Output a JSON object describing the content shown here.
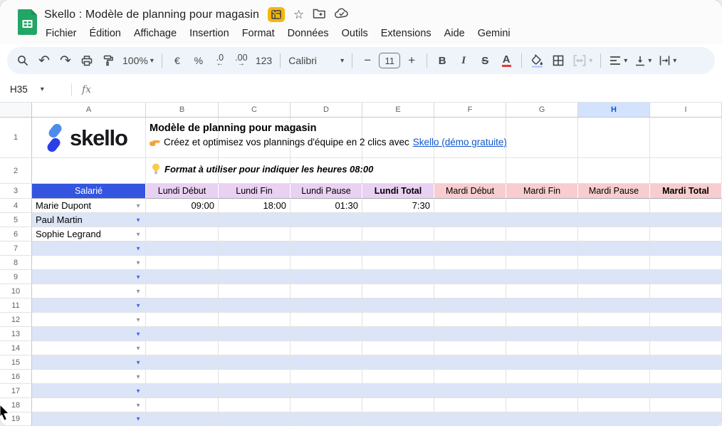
{
  "window": {
    "title": "Skello : Modèle de planning pour magasin"
  },
  "titlebar": {
    "icons": [
      "sheets-logo",
      "xlsx-badge",
      "star-icon",
      "move-folder-icon",
      "cloud-saved-icon"
    ],
    "star": "☆"
  },
  "menu": {
    "items": [
      "Fichier",
      "Édition",
      "Affichage",
      "Insertion",
      "Format",
      "Données",
      "Outils",
      "Extensions",
      "Aide",
      "Gemini"
    ]
  },
  "toolbar": {
    "undo": "↶",
    "redo": "↷",
    "zoom": "100%",
    "caret": "▾",
    "currency": "€",
    "percent": "%",
    "dec_decrease": ".0",
    "dec_decrease_arrow": "←",
    "dec_increase": ".00",
    "dec_increase_arrow": "→",
    "number_format": "123",
    "font": "Calibri",
    "minus": "−",
    "font_size": "11",
    "plus": "+",
    "bold": "B",
    "italic": "I",
    "strike": "S",
    "text_color": "A"
  },
  "formula_bar": {
    "cell_ref": "H35",
    "fx": "fx"
  },
  "content": {
    "logo_text": "skello",
    "doc_title": "Modèle de planning pour magasin",
    "subtitle_prefix": "Créez et optimisez vos plannings d'équipe en 2 clics avec ",
    "subtitle_link": "Skello (démo gratuite)",
    "tip": "Format à utiliser pour indiquer les heures 08:00"
  },
  "colors": {
    "salarie": "#3355DF",
    "lundi": "#E9D1F3",
    "mardi": "#F8CDCF",
    "band": "#DCE5F7",
    "white": "#FFFFFF",
    "selected_col_bg": "#D3E3FD",
    "selected_col_text": "#0B57D0",
    "link": "#1155CC",
    "dd_blue": "#3D6BE4",
    "dd_gray": "#8a8f94"
  },
  "sheet": {
    "gutter_w": 45,
    "selected_col": "H",
    "columns": [
      {
        "label": "A",
        "w": 160
      },
      {
        "label": "B",
        "w": 102
      },
      {
        "label": "C",
        "w": 101
      },
      {
        "label": "D",
        "w": 101
      },
      {
        "label": "E",
        "w": 101
      },
      {
        "label": "F",
        "w": 101
      },
      {
        "label": "G",
        "w": 101
      },
      {
        "label": "H",
        "w": 101
      },
      {
        "label": "I",
        "w": 101
      }
    ],
    "rows": [
      {
        "n": "1",
        "h": 57
      },
      {
        "n": "2",
        "h": 36
      },
      {
        "n": "3",
        "h": 21,
        "hdr": 1,
        "cells": {
          "A": {
            "t": "Salarié",
            "bg": "salarie",
            "fg": "#FFFFFF",
            "al": "c"
          },
          "B": {
            "t": "Lundi Début",
            "bg": "lundi",
            "al": "c"
          },
          "C": {
            "t": "Lundi Fin",
            "bg": "lundi",
            "al": "c"
          },
          "D": {
            "t": "Lundi Pause",
            "bg": "lundi",
            "al": "c"
          },
          "E": {
            "t": "Lundi Total",
            "bg": "lundi",
            "al": "c",
            "b": 1
          },
          "F": {
            "t": "Mardi Début",
            "bg": "mardi",
            "al": "c"
          },
          "G": {
            "t": "Mardi Fin",
            "bg": "mardi",
            "al": "c"
          },
          "H": {
            "t": "Mardi Pause",
            "bg": "mardi",
            "al": "c"
          },
          "I": {
            "t": "Mardi Total",
            "bg": "mardi",
            "al": "c",
            "b": 1
          }
        }
      },
      {
        "n": "4",
        "h": 20,
        "cells": {
          "A": {
            "t": "Marie Dupont",
            "dd": "gray"
          },
          "B": {
            "t": "09:00",
            "al": "r"
          },
          "C": {
            "t": "18:00",
            "al": "r"
          },
          "D": {
            "t": "01:30",
            "al": "r"
          },
          "E": {
            "t": "7:30",
            "al": "r"
          }
        }
      },
      {
        "n": "5",
        "h": 20,
        "band": 1,
        "cells": {
          "A": {
            "t": "Paul Martin",
            "dd": "blue"
          }
        }
      },
      {
        "n": "6",
        "h": 20,
        "cells": {
          "A": {
            "t": "Sophie Legrand",
            "dd": "gray"
          }
        }
      },
      {
        "n": "7",
        "h": 20,
        "band": 1,
        "cells": {
          "A": {
            "dd": "blue"
          }
        }
      },
      {
        "n": "8",
        "h": 20,
        "cells": {
          "A": {
            "dd": "gray"
          }
        }
      },
      {
        "n": "9",
        "h": 20,
        "band": 1,
        "cells": {
          "A": {
            "dd": "blue"
          }
        }
      },
      {
        "n": "10",
        "h": 20,
        "cells": {
          "A": {
            "dd": "gray"
          }
        }
      },
      {
        "n": "11",
        "h": 20,
        "band": 1,
        "cells": {
          "A": {
            "dd": "blue"
          }
        }
      },
      {
        "n": "12",
        "h": 20,
        "cells": {
          "A": {
            "dd": "gray"
          }
        }
      },
      {
        "n": "13",
        "h": 20,
        "band": 1,
        "cells": {
          "A": {
            "dd": "blue"
          }
        }
      },
      {
        "n": "14",
        "h": 20,
        "cells": {
          "A": {
            "dd": "gray"
          }
        }
      },
      {
        "n": "15",
        "h": 20,
        "band": 1,
        "cells": {
          "A": {
            "dd": "blue"
          }
        }
      },
      {
        "n": "16",
        "h": 20,
        "cells": {
          "A": {
            "dd": "gray"
          }
        }
      },
      {
        "n": "17",
        "h": 20,
        "band": 1,
        "cells": {
          "A": {
            "dd": "blue"
          }
        }
      },
      {
        "n": "18",
        "h": 20,
        "cells": {
          "A": {
            "dd": "gray"
          }
        }
      },
      {
        "n": "19",
        "h": 19,
        "band": 1,
        "cells": {
          "A": {
            "dd": "blue"
          }
        }
      }
    ]
  }
}
